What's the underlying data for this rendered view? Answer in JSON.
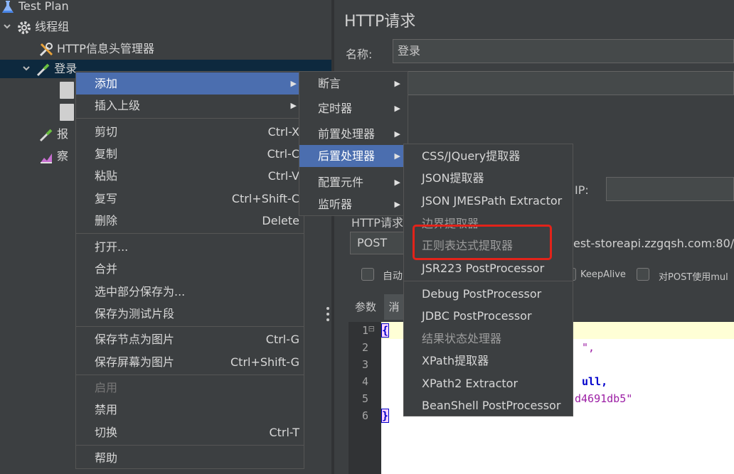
{
  "tree": {
    "items": [
      {
        "label": "Test Plan",
        "icon": "flask-icon"
      },
      {
        "label": "线程组",
        "icon": "gear-icon"
      },
      {
        "label": "HTTP信息头管理器",
        "icon": "wrench-icon"
      },
      {
        "label": "登录",
        "icon": "pipette-icon"
      },
      {
        "label": "报",
        "icon": "pipette-icon"
      },
      {
        "label": "察",
        "icon": "chart-icon"
      }
    ]
  },
  "panel": {
    "title": "HTTP请求",
    "name_label": "名称:",
    "name_value": "登录",
    "ip_label": "IP:",
    "http_request_label": "HTTP请求",
    "method": "POST",
    "url": "est-storeapi.zzgqsh.com:80/s",
    "auto_label": "自动",
    "keepalive_label": "KeepAlive",
    "post_multipart_label": "对POST使用mul",
    "tabs": {
      "params": "参数",
      "body": "消"
    }
  },
  "editor": {
    "line_numbers": [
      "1",
      "2",
      "3",
      "4",
      "5",
      "6"
    ],
    "fold_marker": "⊟",
    "open_brace": "{",
    "close_brace": "}",
    "line2_tail": "\",",
    "line4_tail": "ull,",
    "line5_tail": "d4691db5\""
  },
  "menu_main": {
    "items": [
      {
        "label": "添加",
        "shortcut": "",
        "submenu": true
      },
      {
        "label": "插入上级",
        "shortcut": "",
        "submenu": true
      },
      {
        "label": "剪切",
        "shortcut": "Ctrl-X"
      },
      {
        "label": "复制",
        "shortcut": "Ctrl-C"
      },
      {
        "label": "粘贴",
        "shortcut": "Ctrl-V"
      },
      {
        "label": "复写",
        "shortcut": "Ctrl+Shift-C"
      },
      {
        "label": "删除",
        "shortcut": "Delete"
      },
      {
        "label": "打开...",
        "shortcut": ""
      },
      {
        "label": "合并",
        "shortcut": ""
      },
      {
        "label": "选中部分保存为...",
        "shortcut": ""
      },
      {
        "label": "保存为测试片段",
        "shortcut": ""
      },
      {
        "label": "保存节点为图片",
        "shortcut": "Ctrl-G"
      },
      {
        "label": "保存屏幕为图片",
        "shortcut": "Ctrl+Shift-G"
      },
      {
        "label": "启用",
        "shortcut": ""
      },
      {
        "label": "禁用",
        "shortcut": ""
      },
      {
        "label": "切换",
        "shortcut": "Ctrl-T"
      },
      {
        "label": "帮助",
        "shortcut": ""
      }
    ]
  },
  "menu_add": {
    "items": [
      {
        "label": "断言"
      },
      {
        "label": "定时器"
      },
      {
        "label": "前置处理器"
      },
      {
        "label": "后置处理器"
      },
      {
        "label": "配置元件"
      },
      {
        "label": "监听器"
      }
    ]
  },
  "menu_post": {
    "items": [
      {
        "label": "CSS/JQuery提取器"
      },
      {
        "label": "JSON提取器"
      },
      {
        "label": "JSON JMESPath Extractor"
      },
      {
        "label": "边界提取器"
      },
      {
        "label": "正则表达式提取器"
      },
      {
        "label": "JSR223 PostProcessor"
      },
      {
        "label": "Debug PostProcessor"
      },
      {
        "label": "JDBC PostProcessor"
      },
      {
        "label": "结果状态处理器"
      },
      {
        "label": "XPath提取器"
      },
      {
        "label": "XPath2 Extractor"
      },
      {
        "label": "BeanShell PostProcessor"
      }
    ]
  },
  "colors": {
    "background": "#3c3f41",
    "menu_highlight": "#4b6eaf",
    "annotation_red": "#e2231a"
  }
}
